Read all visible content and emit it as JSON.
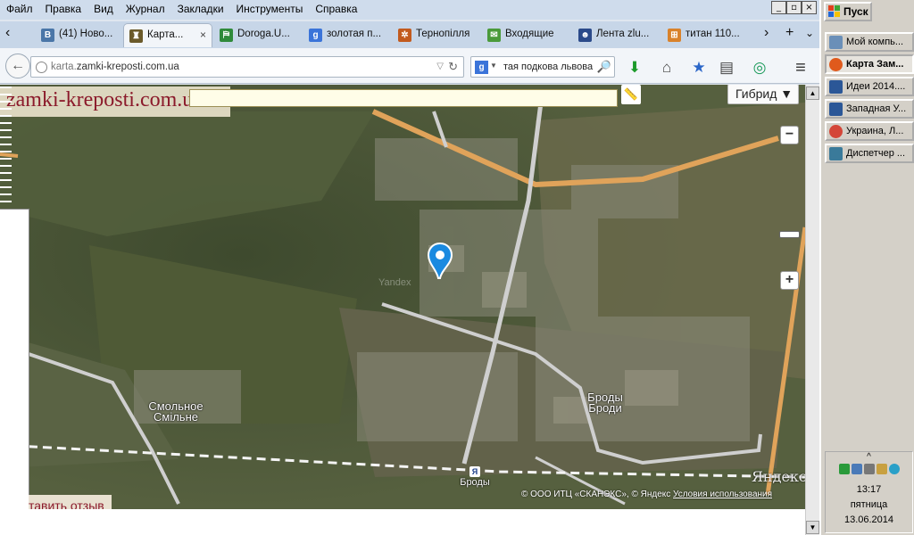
{
  "menu": [
    "Файл",
    "Правка",
    "Вид",
    "Журнал",
    "Закладки",
    "Инструменты",
    "Справка"
  ],
  "window_controls": [
    "_",
    "▫",
    "×"
  ],
  "tabs": [
    {
      "label": "(41) Ново...",
      "icon": "vk-icon",
      "color": "#4a76a8",
      "glyph": "В"
    },
    {
      "label": "Карта...",
      "icon": "castle-favicon-icon",
      "color": "#6b5a2a",
      "glyph": "♜",
      "close": "×"
    },
    {
      "label": "Doroga.U...",
      "icon": "road-sign-icon",
      "color": "#2f8a3a",
      "glyph": "⛿"
    },
    {
      "label": "золотая п...",
      "icon": "google-icon",
      "color": "#3b74d9",
      "glyph": "g"
    },
    {
      "label": "Тернопілля",
      "icon": "ornament-icon",
      "color": "#c25a1e",
      "glyph": "✲"
    },
    {
      "label": "Входящие",
      "icon": "mail-icon",
      "color": "#4a9a3a",
      "glyph": "✉"
    },
    {
      "label": "Лента zlu...",
      "icon": "user-icon",
      "color": "#2b4a8a",
      "glyph": "☻"
    },
    {
      "label": "титан 110...",
      "icon": "windows-icon",
      "color": "#d9822b",
      "glyph": "⊞"
    }
  ],
  "tabbar_controls": {
    "scroll_left": "‹",
    "scroll_right": "›",
    "new_tab": "+",
    "list": "⌄"
  },
  "nav": {
    "back": "←",
    "url_host_prefix": "karta.",
    "url_host_main": "zamki-kreposti.com.ua",
    "url_dropdown": "▽",
    "reload": "↻",
    "search_engine": "g",
    "search_dropdown": "▼",
    "search_value": "тая подкова львова",
    "search_go": "🔎",
    "toolbar_icons": [
      {
        "name": "download-icon",
        "glyph": "⬇",
        "color": "#1c9a2a"
      },
      {
        "name": "home-icon",
        "glyph": "⌂",
        "color": "#444444"
      },
      {
        "name": "bookmark-star-icon",
        "glyph": "★",
        "color": "#2b66c8"
      },
      {
        "name": "reading-list-icon",
        "glyph": "▤",
        "color": "#444444"
      },
      {
        "name": "addon-ring-icon",
        "glyph": "◎",
        "color": "#1a9a5a"
      },
      {
        "name": "hamburger-menu-icon",
        "glyph": "≡",
        "color": "#333333"
      }
    ]
  },
  "map": {
    "site_logo": "zamki-kreposti.com.ua",
    "ruler_glyph": "📏",
    "layer_selector": "Гибрид ▼",
    "zoom_minus": "−",
    "zoom_plus": "+",
    "watermark": "Yandex",
    "labels": [
      {
        "ru": "Смольное",
        "uk": "Смільне"
      },
      {
        "ru": "Броды",
        "uk": "Броди"
      }
    ],
    "station_label": "Броды",
    "station_icon": "Я",
    "yandex_logo": "Яндекс",
    "copyright": "© ООО ИТЦ «СКАНЭКС», © Яндекс",
    "terms": "Условия использования",
    "review_link": "тавить отзыв"
  },
  "page_bottom_text": "",
  "taskbar": {
    "start": "Пуск",
    "buttons": [
      {
        "label": "Мой компь...",
        "icon": "my-computer-icon",
        "color": "#6a8fb8",
        "active": false
      },
      {
        "label": "Карта Зам...",
        "icon": "firefox-icon",
        "color": "#e05a1c",
        "active": true
      },
      {
        "label": "Идеи 2014....",
        "icon": "word-doc-icon",
        "color": "#2b5797",
        "active": false
      },
      {
        "label": "Западная У...",
        "icon": "word-doc-icon",
        "color": "#2b5797",
        "active": false
      },
      {
        "label": "Украина, Л...",
        "icon": "chrome-icon",
        "color": "#d44638",
        "active": false
      },
      {
        "label": "Диспетчер ...",
        "icon": "task-manager-icon",
        "color": "#3a7a9a",
        "active": false
      }
    ],
    "tray": {
      "expand": "^",
      "time": "13:17",
      "weekday": "пятница",
      "date": "13.06.2014"
    }
  }
}
